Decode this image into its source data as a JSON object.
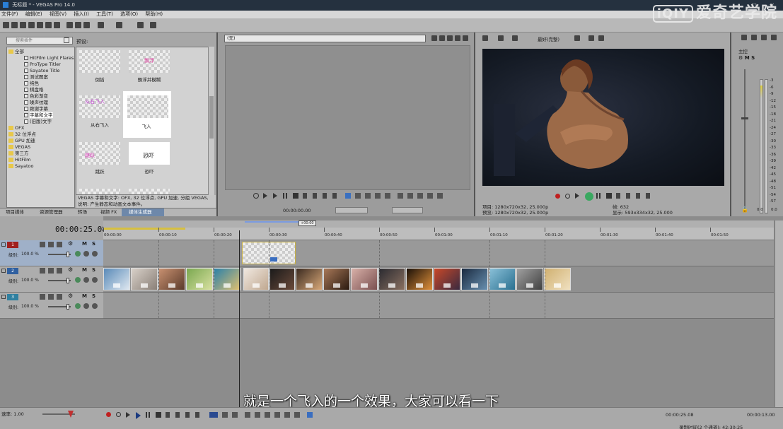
{
  "window": {
    "title": "无标题 * - VEGAS Pro 14.0",
    "buttons": [
      "—",
      "□",
      "✕"
    ]
  },
  "watermark": {
    "logo": "iQIY",
    "text": "爱奇艺学院"
  },
  "menu": [
    "文件(F)",
    "编辑(E)",
    "视图(V)",
    "插入(I)",
    "工具(T)",
    "选项(O)",
    "帮助(H)"
  ],
  "plugins": {
    "search_placeholder": "搜索插件",
    "tree": [
      {
        "label": "全部",
        "type": "folder",
        "indent": 1
      },
      {
        "label": "HitFilm Light Flares",
        "type": "item",
        "indent": 2
      },
      {
        "label": "ProType Titler",
        "type": "item",
        "indent": 2
      },
      {
        "label": "Sayatoo Title",
        "type": "item",
        "indent": 2
      },
      {
        "label": "测试图案",
        "type": "item",
        "indent": 2
      },
      {
        "label": "纯色",
        "type": "item",
        "indent": 2
      },
      {
        "label": "棋盘格",
        "type": "item",
        "indent": 2
      },
      {
        "label": "色彩渐变",
        "type": "item",
        "indent": 2
      },
      {
        "label": "噪声纹理",
        "type": "item",
        "indent": 2
      },
      {
        "label": "致谢字幕",
        "type": "item",
        "indent": 2
      },
      {
        "label": "字幕和文字",
        "type": "item",
        "indent": 2,
        "selected": true
      },
      {
        "label": "(旧版)文字",
        "type": "item",
        "indent": 2
      },
      {
        "label": "OFX",
        "type": "folder",
        "indent": 1
      },
      {
        "label": "32 位浮点",
        "type": "folder",
        "indent": 1
      },
      {
        "label": "GPU 加速",
        "type": "folder",
        "indent": 1
      },
      {
        "label": "VEGAS",
        "type": "folder",
        "indent": 1
      },
      {
        "label": "第三方",
        "type": "folder",
        "indent": 1
      },
      {
        "label": "HitFilm",
        "type": "folder",
        "indent": 1
      },
      {
        "label": "Sayatoo",
        "type": "folder",
        "indent": 1
      }
    ],
    "presets_label": "预设:",
    "presets": [
      {
        "label": "倒插",
        "thumb_text": "",
        "thumb_color": "#60c0e0"
      },
      {
        "label": "飘浮并模糊",
        "thumb_text": "飘浮",
        "thumb_color": "#e040a0"
      },
      {
        "label": "从右飞入",
        "thumb_text": "从右飞入",
        "thumb_color": "#c040d0"
      },
      {
        "label": "飞入",
        "thumb_text": "",
        "thumb_color": "#888888",
        "selected": true
      },
      {
        "label": "跳跃",
        "thumb_text": "跳跃",
        "thumb_color": "#e040c0"
      },
      {
        "label": "恐吓",
        "thumb_text": "恐吓",
        "thumb_color": "#222222"
      }
    ],
    "status_line1": "VEGAS 字幕和文字: OFX, 32 位浮点, GPU 加速, 分组 VEGAS,",
    "status_line2": "说明: 产生静态和动画文本事件。",
    "tabs": [
      "项目媒体",
      "资源管理器",
      "转场",
      "视频 FX",
      "媒体生成器"
    ]
  },
  "trimmer": {
    "dropdown": "(无)",
    "timecode": "00:00:00.00"
  },
  "preview": {
    "quality": "最好(完整)",
    "project_label": "项目:",
    "project_value": "1280x720x32, 25.000p",
    "preview_label": "预览:",
    "preview_value": "1280x720x32, 25.000p",
    "frame_label": "帧:",
    "frame_value": "632",
    "display_label": "显示:",
    "display_value": "593x334x32, 25.000"
  },
  "mixer": {
    "label": "主控",
    "scale": [
      "-3",
      "-6",
      "-9",
      "-12",
      "-15",
      "-18",
      "-21",
      "-24",
      "-27",
      "-30",
      "-33",
      "-36",
      "-39",
      "-42",
      "-45",
      "-48",
      "-51",
      "-54",
      "-57"
    ],
    "bottom_left": "0.0",
    "bottom_right": "0.0"
  },
  "timeline": {
    "timecode": "00:00:25.08",
    "loop_marker": "+00:00",
    "ruler": [
      "00:00:00",
      "00:00:10",
      "00:00:20",
      "00:00:30",
      "00:00:40",
      "00:00:50",
      "00:01:00",
      "00:01:10",
      "00:01:20",
      "00:01:30",
      "00:01:40",
      "00:01:50"
    ],
    "tracks": [
      {
        "number": "1",
        "level_label": "级别:",
        "level_value": "100.0 %"
      },
      {
        "number": "2",
        "level_label": "级别:",
        "level_value": "100.0 %"
      },
      {
        "number": "3",
        "level_label": "级别:",
        "level_value": "100.0 %"
      }
    ],
    "rate_label": "速率: 1.00",
    "end_timecode": "00:00:25.08",
    "duration": "00:00:13.00",
    "record_time": "录制时间(2 个通道): 42:30:25"
  },
  "subtitle": "就是一个飞入的一个效果，大家可以看一下",
  "colors": {
    "titlebar": "#25313f",
    "selected_track": "#9fb0c8",
    "clip_border": "#e8e8e8",
    "text_clip_border": "#c8b040"
  }
}
